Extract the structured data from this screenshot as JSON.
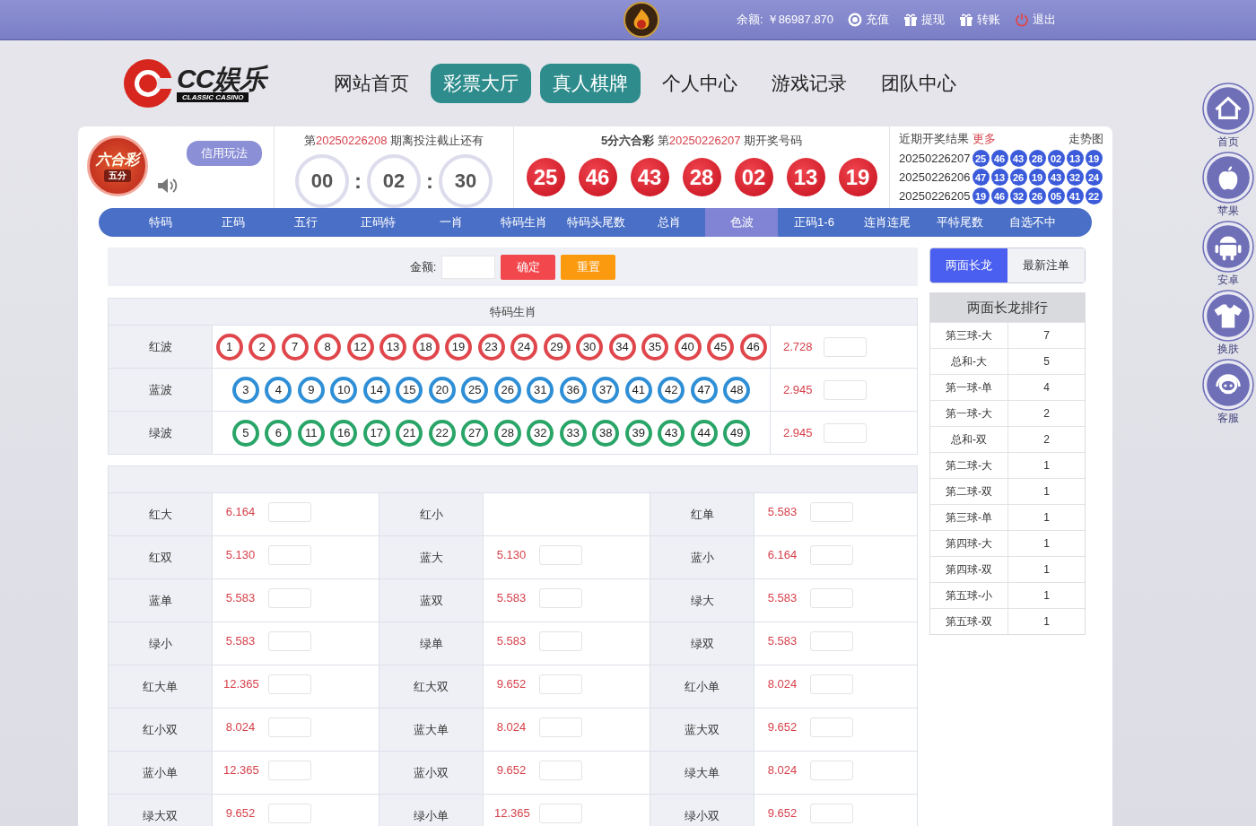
{
  "top_bar": {
    "balance_label": "余额:",
    "balance": "￥86987.870",
    "actions": [
      {
        "kind": "deposit",
        "label": "充值"
      },
      {
        "kind": "gift",
        "label": "提现"
      },
      {
        "kind": "gift",
        "label": "转账"
      },
      {
        "kind": "logout",
        "label": "退出"
      }
    ]
  },
  "logo": {
    "name": "CC娱乐",
    "tagline": "CLASSIC CASINO"
  },
  "nav": [
    {
      "label": "网站首页",
      "highlighted": false
    },
    {
      "label": "彩票大厅",
      "highlighted": true
    },
    {
      "label": "真人棋牌",
      "highlighted": true
    },
    {
      "label": "个人中心",
      "highlighted": false
    },
    {
      "label": "游戏记录",
      "highlighted": false
    },
    {
      "label": "团队中心",
      "highlighted": false
    }
  ],
  "game": {
    "badge_title": "六合彩",
    "badge_sub": "五分",
    "mode_button": "信用玩法"
  },
  "countdown": {
    "prefix": "第",
    "issue": "20250226208",
    "suffix": "期离投注截止还有",
    "parts": [
      "00",
      "02",
      "30"
    ],
    "separators": [
      ":",
      ":"
    ]
  },
  "draw": {
    "game": "5分六合彩",
    "prefix": "第",
    "issue": "20250226207",
    "suffix": "期开奖号码",
    "balls": [
      "25",
      "46",
      "43",
      "28",
      "02",
      "13",
      "19"
    ]
  },
  "recent": {
    "title": "近期开奖结果",
    "more": "更多",
    "trend": "走势图",
    "rows": [
      {
        "issue": "20250226207",
        "balls": [
          "25",
          "46",
          "43",
          "28",
          "02",
          "13",
          "19"
        ]
      },
      {
        "issue": "20250226206",
        "balls": [
          "47",
          "13",
          "26",
          "19",
          "43",
          "32",
          "24"
        ]
      },
      {
        "issue": "20250226205",
        "balls": [
          "19",
          "46",
          "32",
          "26",
          "05",
          "41",
          "22"
        ]
      }
    ]
  },
  "play_tabs": [
    {
      "label": "特码",
      "selected": false
    },
    {
      "label": "正码",
      "selected": false
    },
    {
      "label": "五行",
      "selected": false
    },
    {
      "label": "正码特",
      "selected": false
    },
    {
      "label": "一肖",
      "selected": false
    },
    {
      "label": "特码生肖",
      "selected": false
    },
    {
      "label": "特码头尾数",
      "selected": false
    },
    {
      "label": "总肖",
      "selected": false
    },
    {
      "label": "色波",
      "selected": true
    },
    {
      "label": "正码1-6",
      "selected": false
    },
    {
      "label": "连肖连尾",
      "selected": false
    },
    {
      "label": "平特尾数",
      "selected": false
    },
    {
      "label": "自选不中",
      "selected": false
    }
  ],
  "bet_bar": {
    "amount_label": "金额:",
    "confirm": "确定",
    "reset": "重置"
  },
  "zodiac_table": {
    "title": "特码生肖",
    "rows": [
      {
        "label": "红波",
        "color": "#e0474c",
        "numbers": [
          "1",
          "2",
          "7",
          "8",
          "12",
          "13",
          "18",
          "19",
          "23",
          "24",
          "29",
          "30",
          "34",
          "35",
          "40",
          "45",
          "46"
        ],
        "odds": "2.728"
      },
      {
        "label": "蓝波",
        "color": "#2f8fd6",
        "numbers": [
          "3",
          "4",
          "9",
          "10",
          "14",
          "15",
          "20",
          "25",
          "26",
          "31",
          "36",
          "37",
          "41",
          "42",
          "47",
          "48"
        ],
        "odds": "2.945"
      },
      {
        "label": "绿波",
        "color": "#2aa568",
        "numbers": [
          "5",
          "6",
          "11",
          "16",
          "17",
          "21",
          "22",
          "27",
          "28",
          "32",
          "33",
          "38",
          "39",
          "43",
          "44",
          "49"
        ],
        "odds": "2.945"
      }
    ]
  },
  "combo_table": {
    "rows": [
      [
        {
          "label": "红大",
          "odds": "6.164"
        },
        {
          "label": "红小"
        },
        {
          "label": "红单",
          "odds": "5.583"
        }
      ],
      [
        {
          "label": "红双",
          "odds": "5.130"
        },
        {
          "label": "蓝大",
          "odds": "5.130"
        },
        {
          "label": "蓝小",
          "odds": "6.164"
        }
      ],
      [
        {
          "label": "蓝单",
          "odds": "5.583"
        },
        {
          "label": "蓝双",
          "odds": "5.583"
        },
        {
          "label": "绿大",
          "odds": "5.583"
        }
      ],
      [
        {
          "label": "绿小",
          "odds": "5.583"
        },
        {
          "label": "绿单",
          "odds": "5.583"
        },
        {
          "label": "绿双",
          "odds": "5.583"
        }
      ],
      [
        {
          "label": "红大单",
          "odds": "12.365"
        },
        {
          "label": "红大双",
          "odds": "9.652"
        },
        {
          "label": "红小单",
          "odds": "8.024"
        }
      ],
      [
        {
          "label": "红小双",
          "odds": "8.024"
        },
        {
          "label": "蓝大单",
          "odds": "8.024"
        },
        {
          "label": "蓝大双",
          "odds": "9.652"
        }
      ],
      [
        {
          "label": "蓝小单",
          "odds": "12.365"
        },
        {
          "label": "蓝小双",
          "odds": "9.652"
        },
        {
          "label": "绿大单",
          "odds": "8.024"
        }
      ],
      [
        {
          "label": "绿大双",
          "odds": "9.652"
        },
        {
          "label": "绿小单",
          "odds": "12.365"
        },
        {
          "label": "绿小双",
          "odds": "9.652"
        }
      ]
    ]
  },
  "side_tabs": [
    {
      "label": "两面长龙",
      "selected": true
    },
    {
      "label": "最新注单",
      "selected": false
    }
  ],
  "ranking": {
    "title": "两面长龙排行",
    "rows": [
      {
        "name": "第三球-大",
        "count": "7"
      },
      {
        "name": "总和-大",
        "count": "5"
      },
      {
        "name": "第一球-单",
        "count": "4"
      },
      {
        "name": "第一球-大",
        "count": "2"
      },
      {
        "name": "总和-双",
        "count": "2"
      },
      {
        "name": "第二球-大",
        "count": "1"
      },
      {
        "name": "第二球-双",
        "count": "1"
      },
      {
        "name": "第三球-单",
        "count": "1"
      },
      {
        "name": "第四球-大",
        "count": "1"
      },
      {
        "name": "第四球-双",
        "count": "1"
      },
      {
        "name": "第五球-小",
        "count": "1"
      },
      {
        "name": "第五球-双",
        "count": "1"
      }
    ]
  },
  "quick_links": [
    {
      "kind": "home",
      "label": "首页"
    },
    {
      "kind": "apple",
      "label": "苹果"
    },
    {
      "kind": "android",
      "label": "安卓"
    },
    {
      "kind": "shirt",
      "label": "换肤"
    },
    {
      "kind": "headset",
      "label": "客服"
    }
  ]
}
